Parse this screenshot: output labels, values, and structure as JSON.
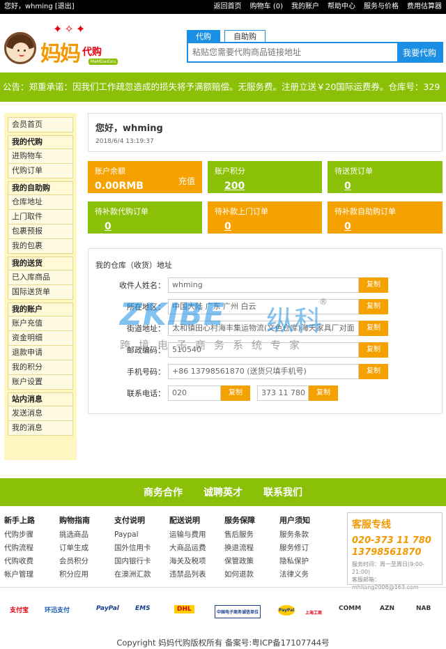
{
  "topbar": {
    "greeting": "您好，whming [退出]",
    "links": [
      "返回首页",
      "购物车 (0)",
      "我的账户",
      "帮助中心",
      "服务与价格",
      "费用估算器"
    ]
  },
  "logo": {
    "text": "妈妈",
    "text2": "代购",
    "sub": "MaMDaiGou"
  },
  "search": {
    "tabs": [
      "代购",
      "自助购"
    ],
    "placeholder": "粘贴您需要代购商品链接地址",
    "button": "我要代购"
  },
  "notice": "公告：郑重承诺：因我们工作疏忽造成的损失将予满额赔偿。无服务费。注册立送￥20国际运费券。仓库号：329",
  "sidebar": {
    "home": "会员首页",
    "groups": [
      {
        "title": "我的代购",
        "items": [
          "进购物车",
          "代购订单"
        ]
      },
      {
        "title": "我的自助购",
        "items": [
          "仓库地址",
          "上门取件",
          "包裹预报",
          "我的包裹"
        ]
      },
      {
        "title": "我的送货",
        "items": [
          "已入库商品",
          "国际送货单"
        ]
      },
      {
        "title": "我的账户",
        "items": [
          "账户充值",
          "资金明细",
          "退款申请",
          "我的积分",
          "账户设置"
        ]
      },
      {
        "title": "站内消息",
        "items": [
          "发送消息",
          "我的消息"
        ]
      }
    ]
  },
  "welcome": {
    "name": "您好，whming",
    "time": "2018/6/4 13:19:37"
  },
  "cards": [
    {
      "label": "账户余额",
      "value": "0.00RMB",
      "action": "充值",
      "color": "orange"
    },
    {
      "label": "账户积分",
      "value": "200",
      "color": "green"
    },
    {
      "label": "待送货订单",
      "value": "0",
      "color": "green"
    },
    {
      "label": "待补款代购订单",
      "value": "0",
      "color": "green"
    },
    {
      "label": "待补款上门订单",
      "value": "0",
      "color": "orange"
    },
    {
      "label": "待补款自助购订单",
      "value": "0",
      "color": "orange"
    }
  ],
  "address": {
    "title": "我的仓库（收货）地址",
    "copy": "复制",
    "fields": [
      {
        "label": "收件人姓名：",
        "value": "whming"
      },
      {
        "label": "所在地区：",
        "value": "中国大陆  广东  广州  白云"
      },
      {
        "label": "街道地址：",
        "value": "太和镇田心村海丰集运物流(文色仓库)海天家具厂对面"
      },
      {
        "label": "邮政编码：",
        "value": "510540"
      },
      {
        "label": "手机号码：",
        "value": "+86 13798561870  (送货只填手机号)"
      },
      {
        "label": "联系电话：",
        "value": "020",
        "value2": "373 11 780"
      }
    ]
  },
  "watermark": {
    "brand": "ZKIBE",
    "cn": "纵科",
    "reg": "®",
    "tagline": "跨境电子商务系统专家"
  },
  "footer_bar": [
    "商务合作",
    "诚聘英才",
    "联系我们"
  ],
  "footer_cols": [
    {
      "title": "新手上路",
      "items": [
        "代购步骤",
        "代购流程",
        "代购收费",
        "帐户管理"
      ]
    },
    {
      "title": "购物指南",
      "items": [
        "挑选商品",
        "订单生成",
        "会员积分",
        "积分应用"
      ]
    },
    {
      "title": "支付说明",
      "items": [
        "Paypal",
        "国外信用卡",
        "国内银行卡",
        "在澳洲汇款"
      ]
    },
    {
      "title": "配送说明",
      "items": [
        "运输与费用",
        "大商品运费",
        "海关及税项",
        "违禁品列表"
      ]
    },
    {
      "title": "服务保障",
      "items": [
        "售后服务",
        "换退流程",
        "保管政策",
        "如何退款"
      ]
    },
    {
      "title": "用户须知",
      "items": [
        "服务条款",
        "服务修订",
        "隐私保护",
        "法律义务"
      ]
    }
  ],
  "service": {
    "title": "客服专线",
    "phone1": "020-373 11 780",
    "phone2": "13798561870",
    "hours": "服务时间：周一至周日(9:00-21:00)",
    "email_label": "客服邮箱：",
    "email": "mhliang2008@163.com"
  },
  "partners": [
    "支付宝",
    "环迅支付",
    "PayPal",
    "EMS",
    "DHL",
    "中国电子商务诚信单位",
    "PayPal",
    "上海工商",
    "COMM",
    "AZN",
    "NAB"
  ],
  "copyright": "Copyright 妈妈代购版权所有 备案号:粤ICP备17107744号"
}
